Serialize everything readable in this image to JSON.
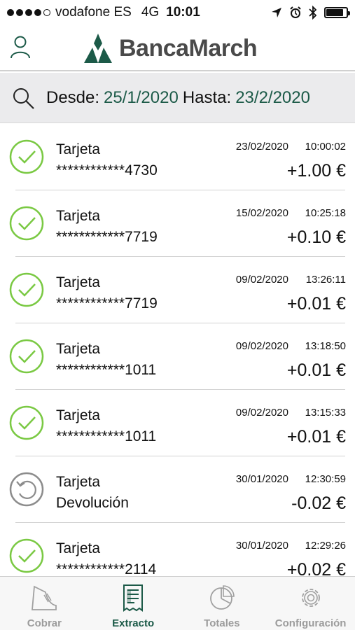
{
  "status_bar": {
    "carrier": "vodafone ES",
    "network": "4G",
    "time": "10:01",
    "battery_level": 0.85
  },
  "header": {
    "brand": "BancaMarch",
    "brand_color": "#4a4a4a",
    "icons": [
      "user-icon",
      "banca-march-logo"
    ]
  },
  "filter": {
    "from_label": "Desde:",
    "from_value": "25/1/2020",
    "to_label": "Hasta:",
    "to_value": "23/2/2020",
    "icon": "search-icon"
  },
  "colors": {
    "accent": "#1c5a48",
    "success": "#7ac943",
    "refund": "#8c8c8c"
  },
  "transactions": [
    {
      "status": "success",
      "title": "Tarjeta",
      "subtitle": "************4730",
      "date": "23/02/2020",
      "time": "10:00:02",
      "amount": "+1.00 €"
    },
    {
      "status": "success",
      "title": "Tarjeta",
      "subtitle": "************7719",
      "date": "15/02/2020",
      "time": "10:25:18",
      "amount": "+0.10 €"
    },
    {
      "status": "success",
      "title": "Tarjeta",
      "subtitle": "************7719",
      "date": "09/02/2020",
      "time": "13:26:11",
      "amount": "+0.01 €"
    },
    {
      "status": "success",
      "title": "Tarjeta",
      "subtitle": "************1011",
      "date": "09/02/2020",
      "time": "13:18:50",
      "amount": "+0.01 €"
    },
    {
      "status": "success",
      "title": "Tarjeta",
      "subtitle": "************1011",
      "date": "09/02/2020",
      "time": "13:15:33",
      "amount": "+0.01 €"
    },
    {
      "status": "refund",
      "title": "Tarjeta",
      "subtitle": "Devolución",
      "date": "30/01/2020",
      "time": "12:30:59",
      "amount": "-0.02 €"
    },
    {
      "status": "success",
      "title": "Tarjeta",
      "subtitle": "************2114",
      "date": "30/01/2020",
      "time": "12:29:26",
      "amount": "+0.02 €"
    }
  ],
  "tabs": [
    {
      "label": "Cobrar",
      "icon": "charge-icon",
      "active": false
    },
    {
      "label": "Extracto",
      "icon": "receipt-icon",
      "active": true
    },
    {
      "label": "Totales",
      "icon": "pie-chart-icon",
      "active": false
    },
    {
      "label": "Configuración",
      "icon": "gear-icon",
      "active": false
    }
  ]
}
